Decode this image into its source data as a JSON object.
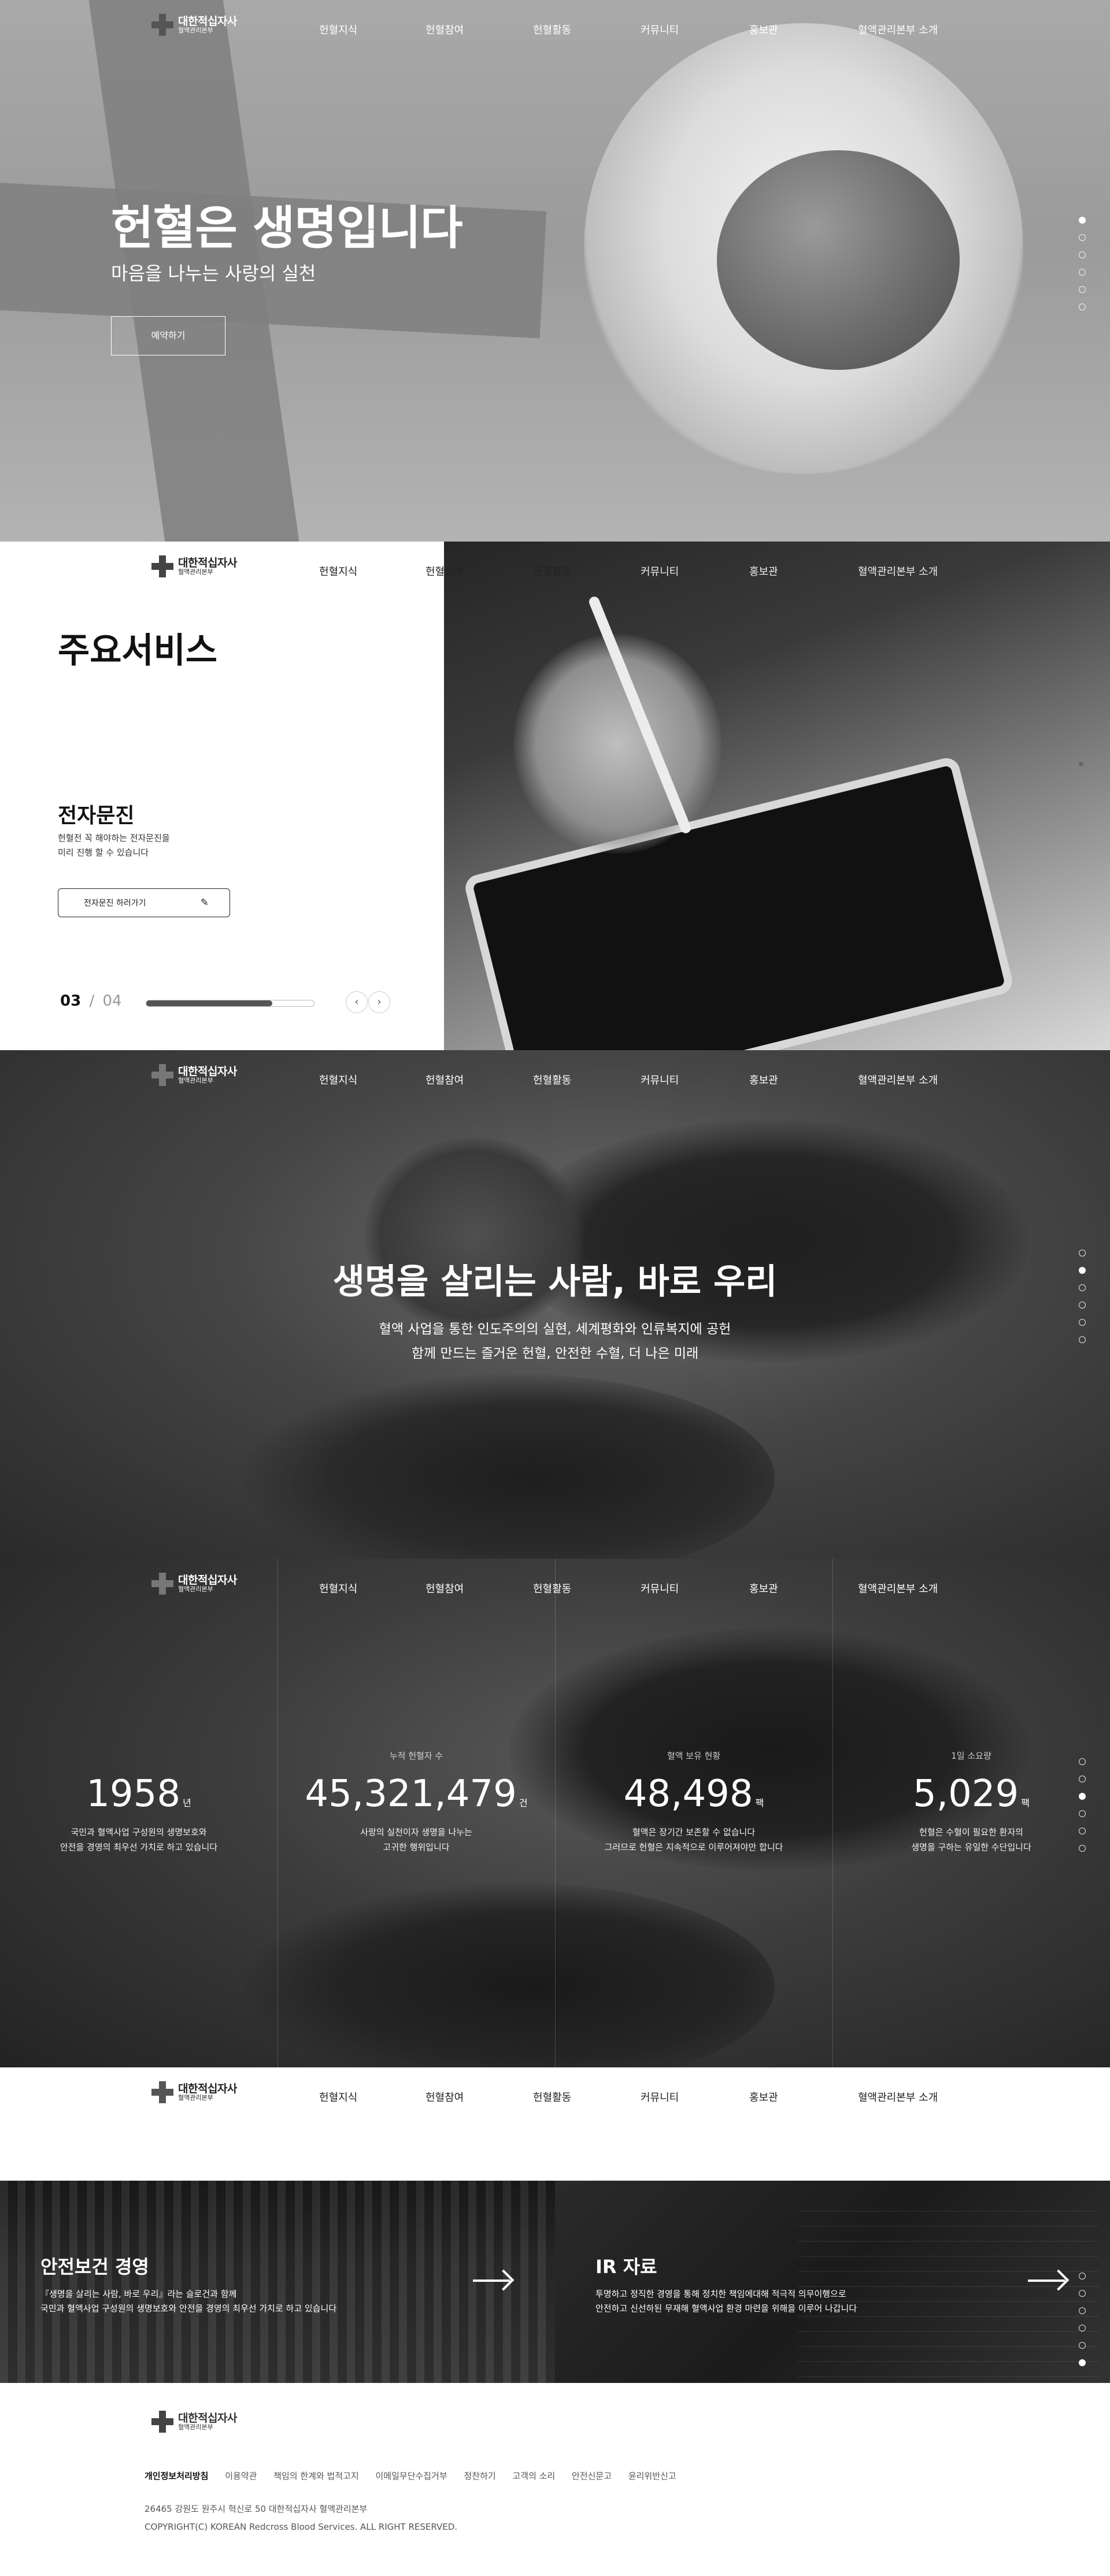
{
  "logo": {
    "name": "대한적십자사",
    "sub": "혈액관리본부"
  },
  "menu": [
    "헌혈지식",
    "헌혈참여",
    "헌혈활동",
    "커뮤니티",
    "홍보관",
    "혈액관리본부 소개"
  ],
  "hero": {
    "title": "헌혈은 생명입니다",
    "subtitle": "마음을 나누는 사랑의 실천",
    "button": "예약하기"
  },
  "service": {
    "section_title": "주요서비스",
    "item_title": "전자문진",
    "item_desc_1": "헌혈전 꼭 해야하는 전자문진을",
    "item_desc_2": "미리 진행 할 수 있습니다",
    "button": "전자문진 하러가기",
    "current": "03",
    "separator": "/",
    "total": "04",
    "progress": 0.75
  },
  "people": {
    "title": "생명을 살리는 사람, 바로 우리",
    "desc_1": "혈액 사업을 통한 인도주의의 실현, 세계평화와 인류복지에 공헌",
    "desc_2": "함께 만드는 즐거운 헌혈, 안전한 수혈, 더 나은 미래"
  },
  "stats": [
    {
      "label": "",
      "value": "1958",
      "unit": "년",
      "desc_1": "국민과 혈액사업 구성원의 생명보호와",
      "desc_2": "안전을 경영의 최우선 가치로 하고 있습니다"
    },
    {
      "label": "누적 헌혈자 수",
      "value": "45,321,479",
      "unit": "건",
      "desc_1": "사랑의 실천이자 생명을 나누는",
      "desc_2": "고귀한 행위입니다"
    },
    {
      "label": "혈액 보유 현황",
      "value": "48,498",
      "unit": "팩",
      "desc_1": "혈액은 장기간 보존할 수 없습니다",
      "desc_2": "그러므로 헌혈은 지속적으로 이루어져야만 합니다"
    },
    {
      "label": "1일 소요량",
      "value": "5,029",
      "unit": "팩",
      "desc_1": "헌혈은 수혈이 필요한 환자의",
      "desc_2": "생명을 구하는 유일한 수단입니다"
    }
  ],
  "banners": [
    {
      "title": "안전보건 경영",
      "desc_1": "『생명을 살리는 사람, 바로 우리』라는 슬로건과 함께",
      "desc_2": "국민과 혈액사업 구성원의 생명보호와 안전을 경영의 최우선 가치로 하고 있습니다"
    },
    {
      "title": "IR 자료",
      "desc_1": "투명하고 정직한 경영을 통해 정치한 책임에대해 적극적 의무이행으로",
      "desc_2": "안전하고 신선하된 무재해 혈액사업 환경 마련을 위해을 이루어 나갑니다"
    }
  ],
  "footer": {
    "links": [
      "개인정보처리방침",
      "이용약관",
      "책임의 한계와 법적고지",
      "이메일무단수집거부",
      "정찬하기",
      "고객의 소리",
      "안전신문고",
      "윤리위반신고"
    ],
    "address": "26465 강원도 원주시 혁신로 50 대한적십자사 혈액관리본부",
    "copyright": "COPYRIGHT(C) KOREAN Redcross Blood Services. ALL RIGHT RESERVED."
  },
  "colors": {
    "dark_text": "#111111",
    "white": "#ffffff"
  }
}
